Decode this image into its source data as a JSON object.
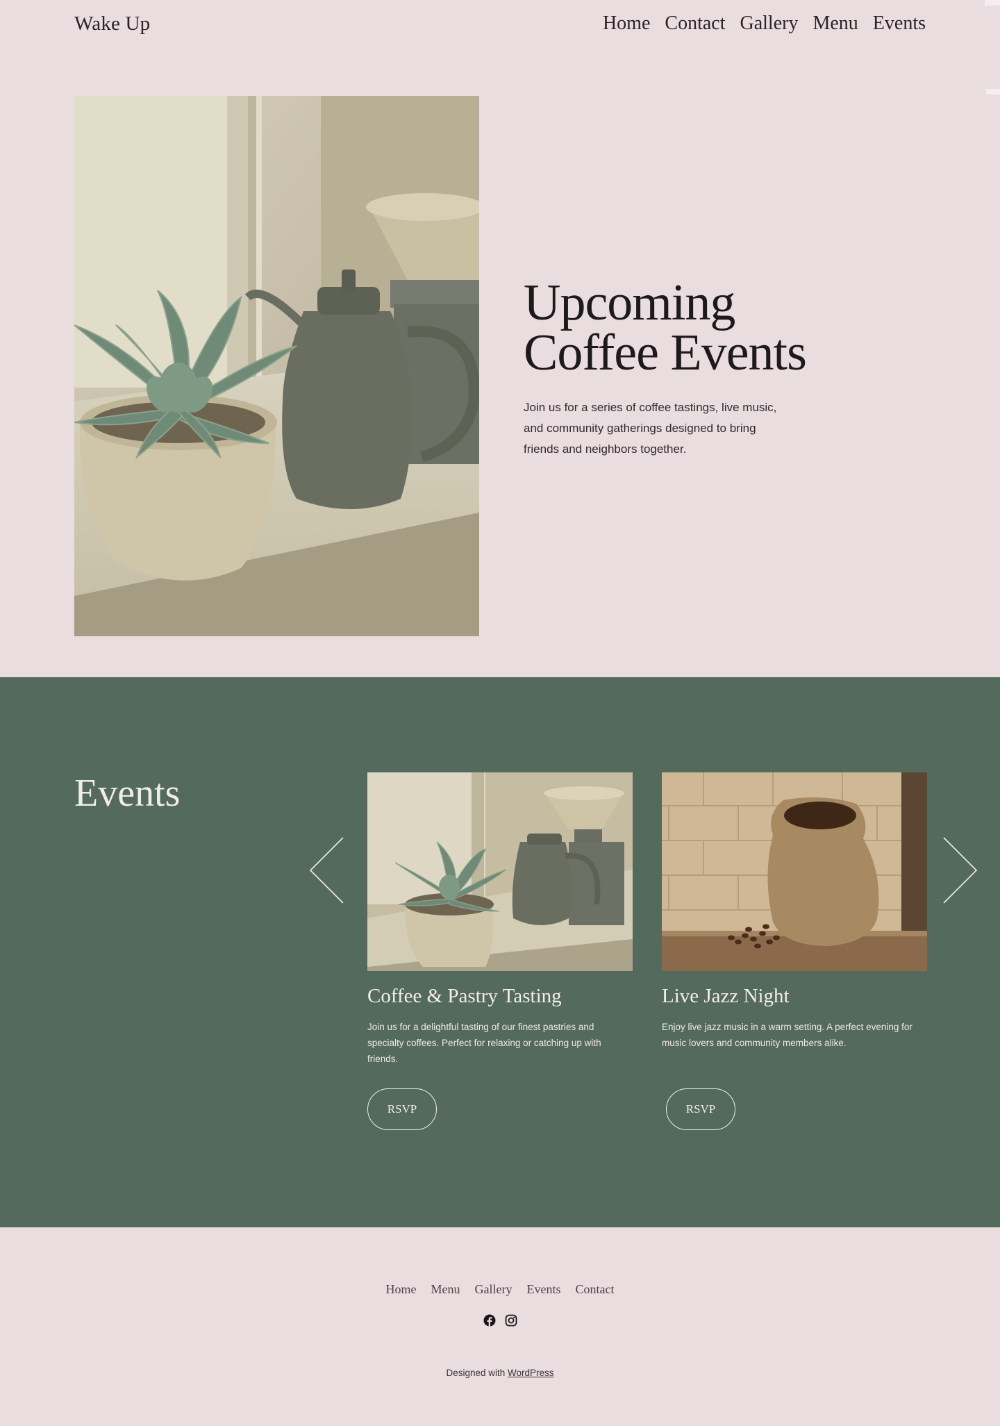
{
  "header": {
    "site_title": "Wake Up",
    "nav": [
      "Home",
      "Contact",
      "Gallery",
      "Menu",
      "Events"
    ]
  },
  "hero": {
    "title_line1": "Upcoming",
    "title_line2": "Coffee Events",
    "description": "Join us for a series of coffee tastings, live music, and community gatherings designed to bring friends and neighbors together."
  },
  "events": {
    "title": "Events",
    "cards": [
      {
        "title": "Coffee & Pastry Tasting",
        "description": "Join us for a delightful tasting of our finest pastries and specialty coffees. Perfect for relaxing or catching up with friends.",
        "button": "RSVP"
      },
      {
        "title": "Live Jazz Night",
        "description": "Enjoy live jazz music in a warm setting. A perfect evening for music lovers and community members alike.",
        "button": "RSVP"
      }
    ],
    "prev_icon": "chevron-left-icon",
    "next_icon": "chevron-right-icon"
  },
  "footer": {
    "nav": [
      "Home",
      "Menu",
      "Gallery",
      "Events",
      "Contact"
    ],
    "social": [
      "facebook-icon",
      "instagram-icon"
    ],
    "credit_prefix": "Designed with",
    "credit_link": "WordPress"
  },
  "colors": {
    "background": "#e9dde0",
    "events_background": "#536a5c",
    "text_light": "#f3eee8"
  }
}
